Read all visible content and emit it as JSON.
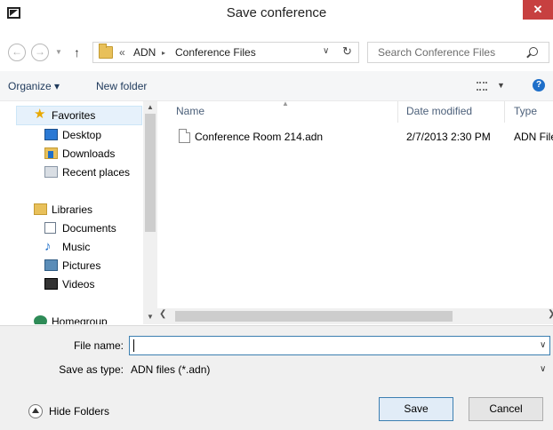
{
  "window": {
    "title": "Save conference",
    "close_symbol": "✕"
  },
  "address": {
    "back_symbol": "←",
    "forward_symbol": "→",
    "up_symbol": "↑",
    "overflow_symbol": "«",
    "breadcrumb": [
      "ADN",
      "Conference Files"
    ],
    "separator": "▸",
    "search_placeholder": "Search Conference Files"
  },
  "toolbar": {
    "organize_label": "Organize ▾",
    "new_folder_label": "New folder",
    "help_symbol": "?"
  },
  "nav": {
    "favorites": [
      {
        "label": "Favorites",
        "icon": "star-icon"
      },
      {
        "label": "Desktop",
        "icon": "desktop-icon"
      },
      {
        "label": "Downloads",
        "icon": "downloads-icon"
      },
      {
        "label": "Recent places",
        "icon": "recent-places-icon"
      }
    ],
    "libraries": [
      {
        "label": "Libraries",
        "icon": "libraries-icon"
      },
      {
        "label": "Documents",
        "icon": "documents-icon"
      },
      {
        "label": "Music",
        "icon": "music-icon"
      },
      {
        "label": "Pictures",
        "icon": "pictures-icon"
      },
      {
        "label": "Videos",
        "icon": "videos-icon"
      }
    ],
    "homegroup": {
      "label": "Homegroup",
      "icon": "homegroup-icon"
    }
  },
  "files": {
    "columns": [
      "Name",
      "Date modified",
      "Type"
    ],
    "rows": [
      {
        "name": "Conference Room 214.adn",
        "date": "2/7/2013 2:30 PM",
        "type": "ADN File"
      }
    ]
  },
  "form": {
    "file_name_label": "File name:",
    "file_name_value": "",
    "save_as_type_label": "Save as type:",
    "save_as_type_value": "ADN files (*.adn)"
  },
  "buttons": {
    "hide_folders": "Hide Folders",
    "save": "Save",
    "cancel": "Cancel"
  },
  "colors": {
    "accent": "#3c7fb1",
    "close": "#c74040",
    "selection": "#e6f1fb"
  }
}
